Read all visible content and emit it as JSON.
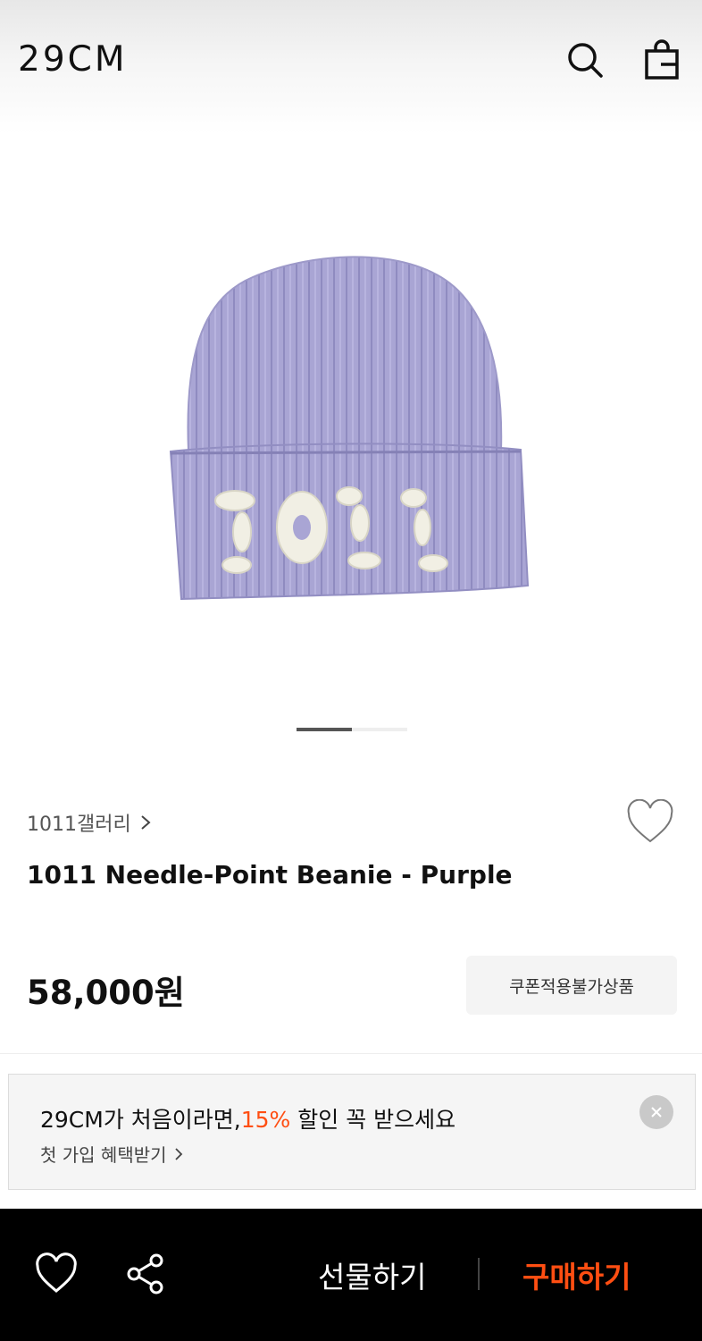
{
  "header": {
    "logo": "29CM",
    "search_icon": "search-icon",
    "bag_icon": "shopping-bag-icon"
  },
  "gallery": {
    "image_subject": "purple ribbed knit beanie with white needle-point 1011 lettering",
    "embroidery_text": "1011",
    "page_total": 2,
    "page_current": 1
  },
  "product": {
    "brand": "1011갤러리",
    "brand_chevron": ">",
    "name": "1011 Needle-Point Beanie - Purple",
    "price": "58,000원",
    "coupon_badge": "쿠폰적용불가상품",
    "wish_icon": "heart-outline-icon"
  },
  "promo": {
    "title_prefix": "29CM가 처음이라면,",
    "title_accent": "15%",
    "title_suffix": " 할인 꼭 받으세요",
    "link_text": "첫 가입 혜택받기",
    "link_chevron": ">",
    "close_icon": "close-icon"
  },
  "bottom_bar": {
    "wish_icon": "heart-outline-icon",
    "share_icon": "share-icon",
    "gift_label": "선물하기",
    "buy_label": "구매하기"
  },
  "colors": {
    "accent": "#ff4e12",
    "bottom_bar_bg": "#000000",
    "beanie": "#a8a4d3"
  }
}
